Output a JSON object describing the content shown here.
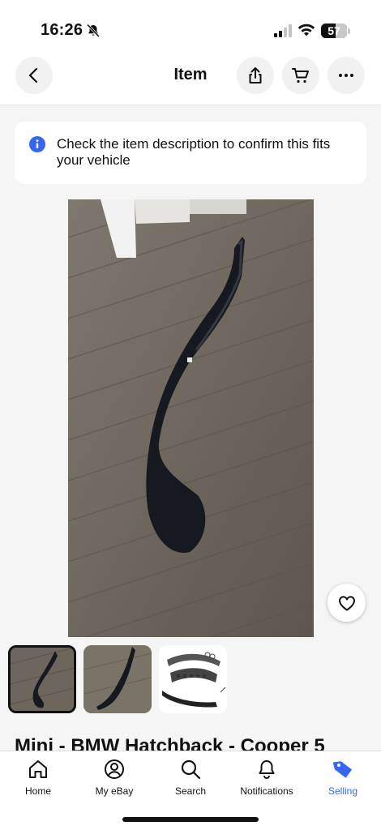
{
  "status": {
    "time": "16:26",
    "battery": "57"
  },
  "nav": {
    "title": "Item"
  },
  "notice": {
    "text": "Check the item description to confirm this fits your vehicle"
  },
  "item": {
    "title": "Mini - BMW Hatchback - Cooper 5"
  },
  "tabs": [
    {
      "label": "Home",
      "icon": "home-icon"
    },
    {
      "label": "My eBay",
      "icon": "user-icon"
    },
    {
      "label": "Search",
      "icon": "search-icon"
    },
    {
      "label": "Notifications",
      "icon": "bell-icon"
    },
    {
      "label": "Selling",
      "icon": "tag-icon"
    }
  ],
  "colors": {
    "accent": "#3665f3",
    "info": "#3665f3"
  }
}
